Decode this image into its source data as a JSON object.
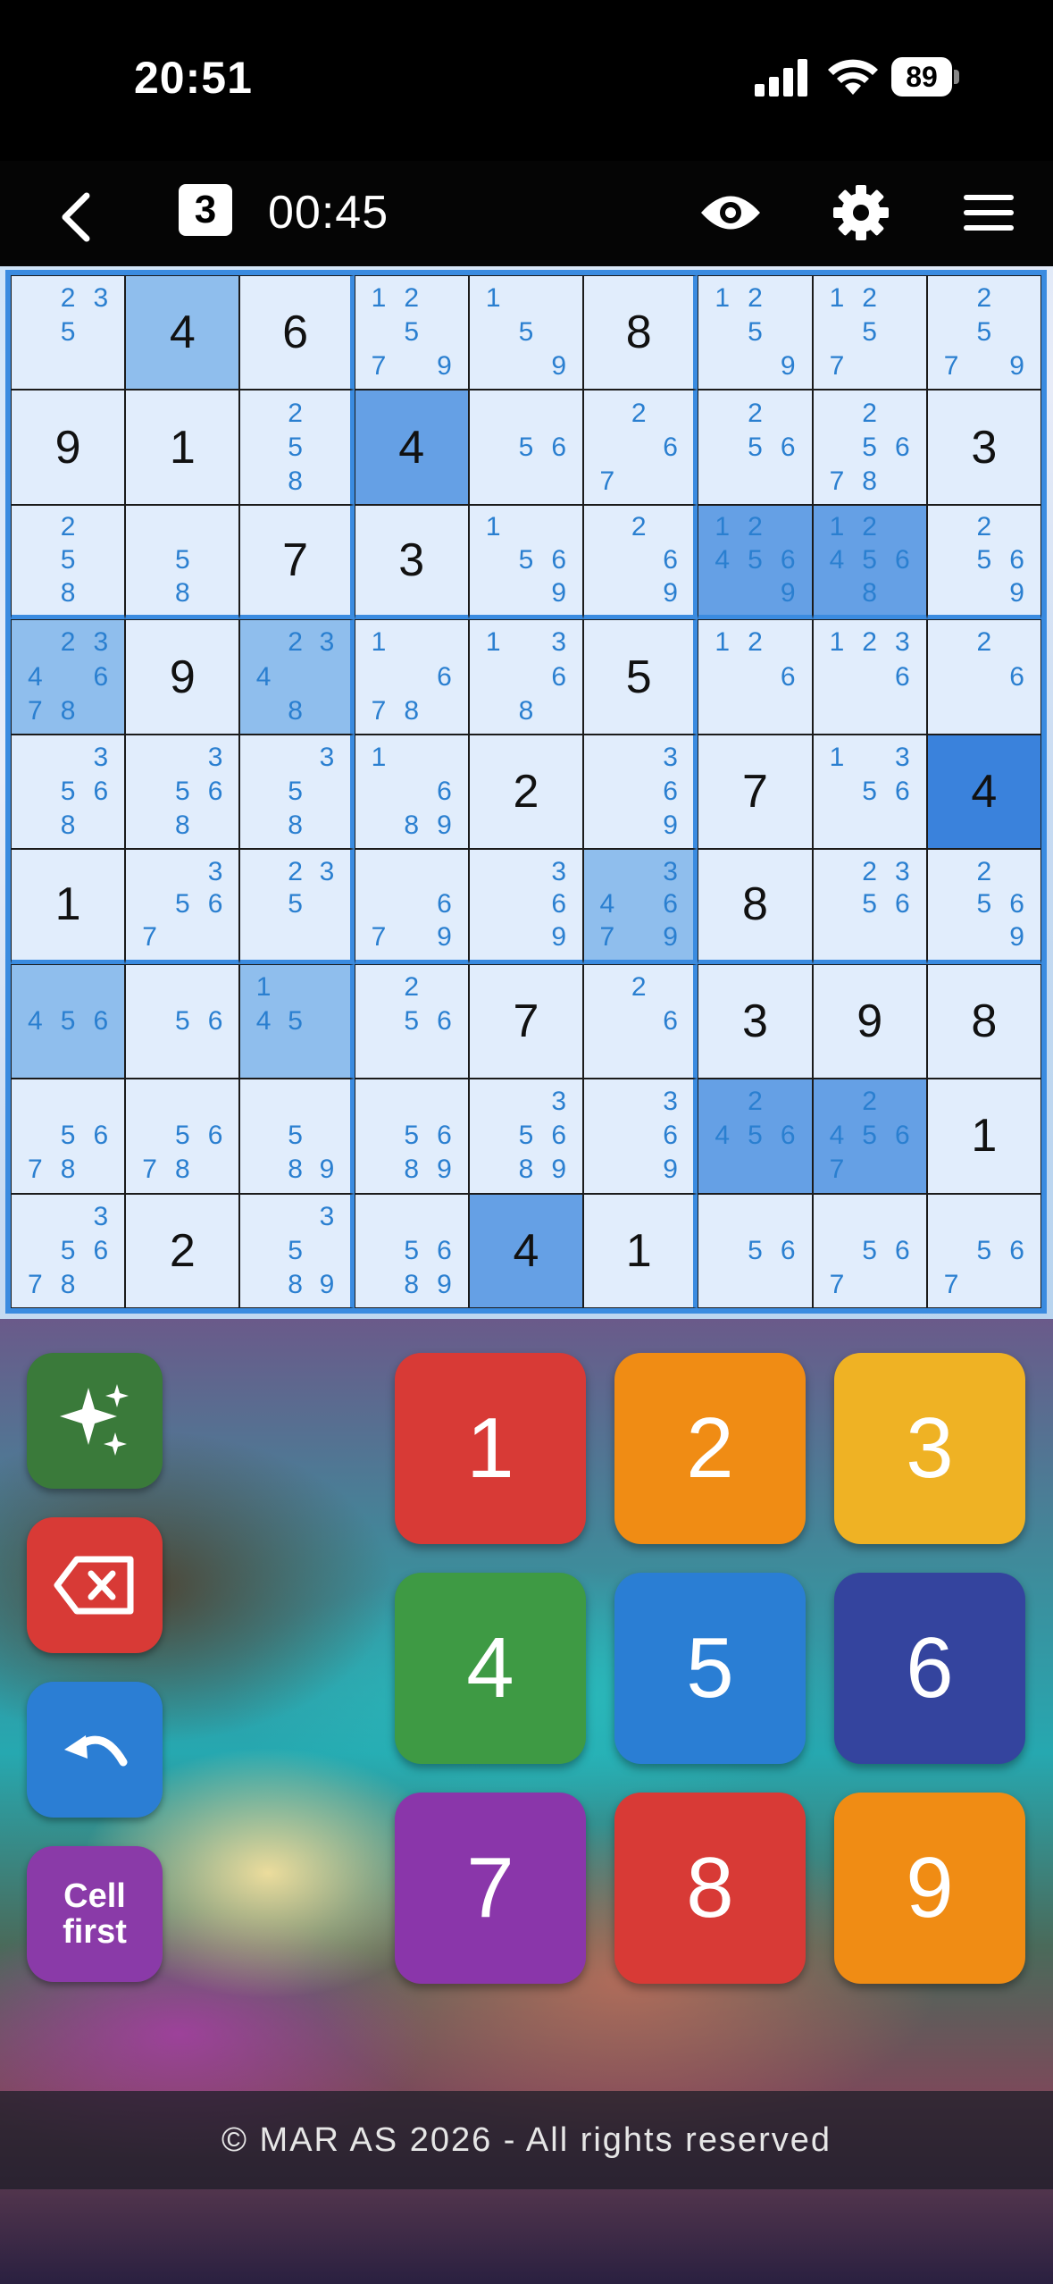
{
  "status_bar": {
    "time": "20:51",
    "battery": "89"
  },
  "toolbar": {
    "level": "3",
    "timer": "00:45"
  },
  "board": {
    "cells": [
      [
        {
          "c": [
            2,
            3,
            5
          ]
        },
        {
          "v": "4",
          "h": 1
        },
        {
          "v": "6"
        },
        {
          "c": [
            1,
            2,
            5,
            7,
            9
          ]
        },
        {
          "c": [
            1,
            5,
            9
          ]
        },
        {
          "v": "8"
        },
        {
          "c": [
            1,
            2,
            5,
            9
          ]
        },
        {
          "c": [
            1,
            2,
            5,
            7
          ]
        },
        {
          "c": [
            2,
            5,
            7,
            9
          ]
        }
      ],
      [
        {
          "v": "9"
        },
        {
          "v": "1"
        },
        {
          "c": [
            2,
            5,
            8
          ]
        },
        {
          "v": "4",
          "h": 2
        },
        {
          "c": [
            5,
            6
          ]
        },
        {
          "c": [
            2,
            6,
            7
          ]
        },
        {
          "c": [
            2,
            5,
            6
          ]
        },
        {
          "c": [
            2,
            5,
            6,
            7,
            8
          ]
        },
        {
          "v": "3"
        }
      ],
      [
        {
          "c": [
            2,
            5,
            8
          ]
        },
        {
          "c": [
            5,
            8
          ]
        },
        {
          "v": "7"
        },
        {
          "v": "3"
        },
        {
          "c": [
            1,
            5,
            6,
            9
          ]
        },
        {
          "c": [
            2,
            6,
            9
          ]
        },
        {
          "c": [
            1,
            2,
            4,
            5,
            6,
            9
          ],
          "h": 2
        },
        {
          "c": [
            1,
            2,
            4,
            5,
            6,
            8
          ],
          "h": 2
        },
        {
          "c": [
            2,
            5,
            6,
            9
          ]
        }
      ],
      [
        {
          "c": [
            2,
            3,
            4,
            6,
            7,
            8
          ],
          "h": 1
        },
        {
          "v": "9"
        },
        {
          "c": [
            2,
            3,
            4,
            8
          ],
          "h": 1
        },
        {
          "c": [
            1,
            6,
            7,
            8
          ]
        },
        {
          "c": [
            1,
            3,
            6,
            8
          ]
        },
        {
          "v": "5"
        },
        {
          "c": [
            1,
            2,
            6
          ]
        },
        {
          "c": [
            1,
            2,
            3,
            6
          ]
        },
        {
          "c": [
            2,
            6
          ]
        }
      ],
      [
        {
          "c": [
            3,
            5,
            6,
            8
          ]
        },
        {
          "c": [
            3,
            5,
            6,
            8
          ]
        },
        {
          "c": [
            3,
            5,
            8
          ]
        },
        {
          "c": [
            1,
            6,
            8,
            9
          ]
        },
        {
          "v": "2"
        },
        {
          "c": [
            3,
            6,
            9
          ]
        },
        {
          "v": "7"
        },
        {
          "c": [
            1,
            3,
            5,
            6
          ]
        },
        {
          "v": "4",
          "h": 3
        }
      ],
      [
        {
          "v": "1"
        },
        {
          "c": [
            3,
            5,
            6,
            7
          ]
        },
        {
          "c": [
            2,
            3,
            5
          ]
        },
        {
          "c": [
            6,
            7,
            9
          ]
        },
        {
          "c": [
            3,
            6,
            9
          ]
        },
        {
          "c": [
            3,
            4,
            6,
            7,
            9
          ],
          "h": 1
        },
        {
          "v": "8"
        },
        {
          "c": [
            2,
            3,
            5,
            6
          ]
        },
        {
          "c": [
            2,
            5,
            6,
            9
          ]
        }
      ],
      [
        {
          "c": [
            4,
            5,
            6
          ],
          "h": 1
        },
        {
          "c": [
            5,
            6
          ]
        },
        {
          "c": [
            1,
            4,
            5
          ],
          "h": 1
        },
        {
          "c": [
            2,
            5,
            6
          ]
        },
        {
          "v": "7"
        },
        {
          "c": [
            2,
            6
          ]
        },
        {
          "v": "3"
        },
        {
          "v": "9"
        },
        {
          "v": "8"
        }
      ],
      [
        {
          "c": [
            5,
            6,
            7,
            8
          ]
        },
        {
          "c": [
            5,
            6,
            7,
            8
          ]
        },
        {
          "c": [
            5,
            8,
            9
          ]
        },
        {
          "c": [
            5,
            6,
            8,
            9
          ]
        },
        {
          "c": [
            3,
            5,
            6,
            8,
            9
          ]
        },
        {
          "c": [
            3,
            6,
            9
          ]
        },
        {
          "c": [
            2,
            4,
            5,
            6
          ],
          "h": 2
        },
        {
          "c": [
            2,
            4,
            5,
            6,
            7
          ],
          "h": 2
        },
        {
          "v": "1"
        }
      ],
      [
        {
          "c": [
            3,
            5,
            6,
            7,
            8
          ]
        },
        {
          "v": "2"
        },
        {
          "c": [
            3,
            5,
            8,
            9
          ]
        },
        {
          "c": [
            5,
            6,
            8,
            9
          ]
        },
        {
          "v": "4",
          "h": 2
        },
        {
          "v": "1"
        },
        {
          "c": [
            5,
            6
          ]
        },
        {
          "c": [
            5,
            6,
            7
          ]
        },
        {
          "c": [
            5,
            6,
            7
          ]
        }
      ]
    ]
  },
  "controls": {
    "hint_icon": "sparkles-icon",
    "erase_icon": "backspace-icon",
    "undo_icon": "undo-icon",
    "cell_first_line1": "Cell",
    "cell_first_line2": "first"
  },
  "numpad": [
    {
      "label": "1",
      "color": "#d83a36"
    },
    {
      "label": "2",
      "color": "#f08c14"
    },
    {
      "label": "3",
      "color": "#efb224"
    },
    {
      "label": "4",
      "color": "#3e9a44"
    },
    {
      "label": "5",
      "color": "#2a7ed4"
    },
    {
      "label": "6",
      "color": "#34449e"
    },
    {
      "label": "7",
      "color": "#8a36aa"
    },
    {
      "label": "8",
      "color": "#d83a36"
    },
    {
      "label": "9",
      "color": "#f08c14"
    }
  ],
  "footer": {
    "text": "© MAR AS 2026 - All rights reserved"
  }
}
